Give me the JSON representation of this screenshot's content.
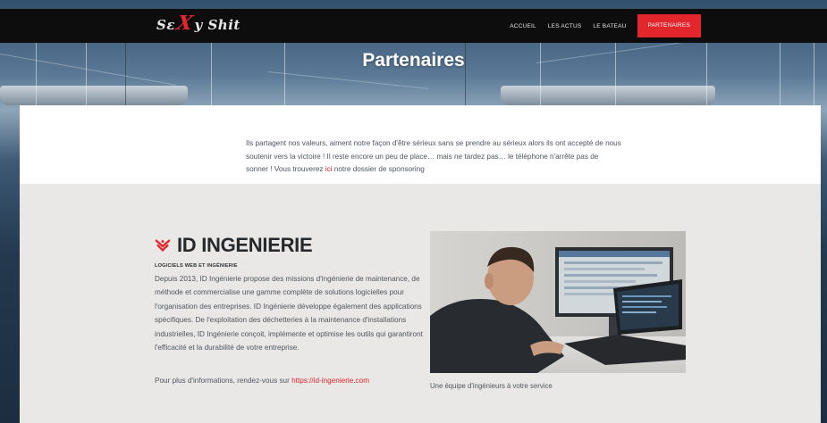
{
  "site": {
    "logo_text_left": "Sɛ",
    "logo_text_x": "X",
    "logo_text_right": "y Shit"
  },
  "nav": {
    "items": [
      {
        "label": "ACCUEIL"
      },
      {
        "label": "LES ACTUS"
      },
      {
        "label": "LE BATEAU"
      },
      {
        "label": "PARTENAIRES"
      }
    ],
    "active": "PARTENAIRES"
  },
  "hero": {
    "title": "Partenaires"
  },
  "intro": {
    "text_before": "Ils partagent nos valeurs, aiment notre façon d'être sérieux sans se prendre au sérieux alors ils ont accepté de nous soutenir vers la victoire ! Il reste encore un peu de place… mais ne tardez pas… le téléphone n'arrête pas de sonner ! Vous trouverez ",
    "link_label": "ici",
    "text_after": " notre dossier de sponsoring"
  },
  "partner": {
    "name": "ID INGENIERIE",
    "subtitle": "LOGICIELS WEB ET INGÉNIERIE",
    "description": "Depuis 2013, ID Ingénierie propose des missions d'ingénierie de maintenance, de méthode et commercialise une gamme complète de solutions logicielles pour l'organisation des entreprises. ID Ingénierie développe également des applications spécifiques. De l'exploitation des déchetteries à la maintenance d'installations industrielles, ID Ingénierie conçoit, implémente et optimise les outils qui garantiront l'efficacité et la durabilité de votre entreprise.",
    "more_text": "Pour plus d'informations, rendez-vous sur ",
    "more_link": "https://id-ingenierie.com",
    "photo_caption": "Une équipe d'ingénieurs à votre service"
  },
  "colors": {
    "accent": "#e3262b",
    "topbar": "#0d0d0d",
    "section_grey": "#eae8e6",
    "text": "#4e5560"
  },
  "icons": {
    "brand": "id-ingenierie-logo-icon"
  }
}
